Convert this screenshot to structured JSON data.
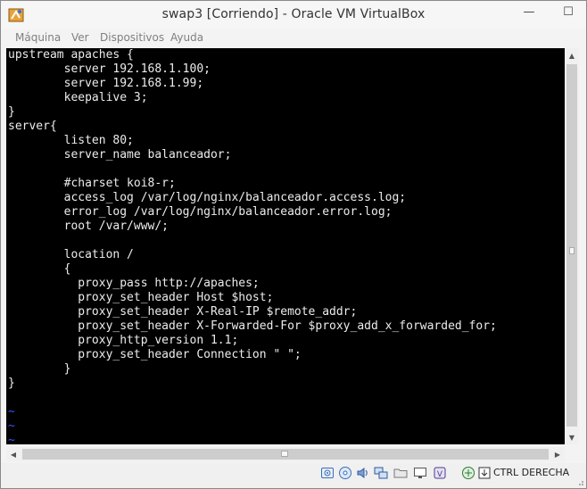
{
  "window": {
    "title": "swap3 [Corriendo] - Oracle VM VirtualBox",
    "minimize_glyph": "—",
    "maximize_glyph": "☐"
  },
  "menu": [
    {
      "label": "Máquina"
    },
    {
      "label": "Ver"
    },
    {
      "label": "Dispositivos"
    },
    {
      "label": "Ayuda"
    }
  ],
  "terminal": {
    "lines": [
      "upstream apaches {",
      "        server 192.168.1.100;",
      "        server 192.168.1.99;",
      "        keepalive 3;",
      "}",
      "server{",
      "        listen 80;",
      "        server_name balanceador;",
      "",
      "        #charset koi8-r;",
      "        access_log /var/log/nginx/balanceador.access.log;",
      "        error_log /var/log/nginx/balanceador.error.log;",
      "        root /var/www/;",
      "",
      "        location /",
      "        {",
      "          proxy_pass http://apaches;",
      "          proxy_set_header Host $host;",
      "          proxy_set_header X-Real-IP $remote_addr;",
      "          proxy_set_header X-Forwarded-For $proxy_add_x_forwarded_for;",
      "          proxy_http_version 1.1;",
      "          proxy_set_header Connection \" \";",
      "        }",
      "}"
    ],
    "empty_line_markers": [
      "~",
      "~",
      "~"
    ]
  },
  "statusbar": {
    "icons": [
      "hard-disk-icon",
      "optical-drive-icon",
      "audio-icon",
      "network-icon",
      "shared-folders-icon",
      "display-icon",
      "video-capture-icon",
      "virtualization-icon",
      "mouse-integration-icon"
    ],
    "host_key": "CTRL DERECHA"
  },
  "colors": {
    "terminal_bg": "#000000",
    "terminal_fg": "#ececec",
    "vim_tilde": "#3a55ff",
    "menu_text_disabled": "#7f7f7f"
  }
}
